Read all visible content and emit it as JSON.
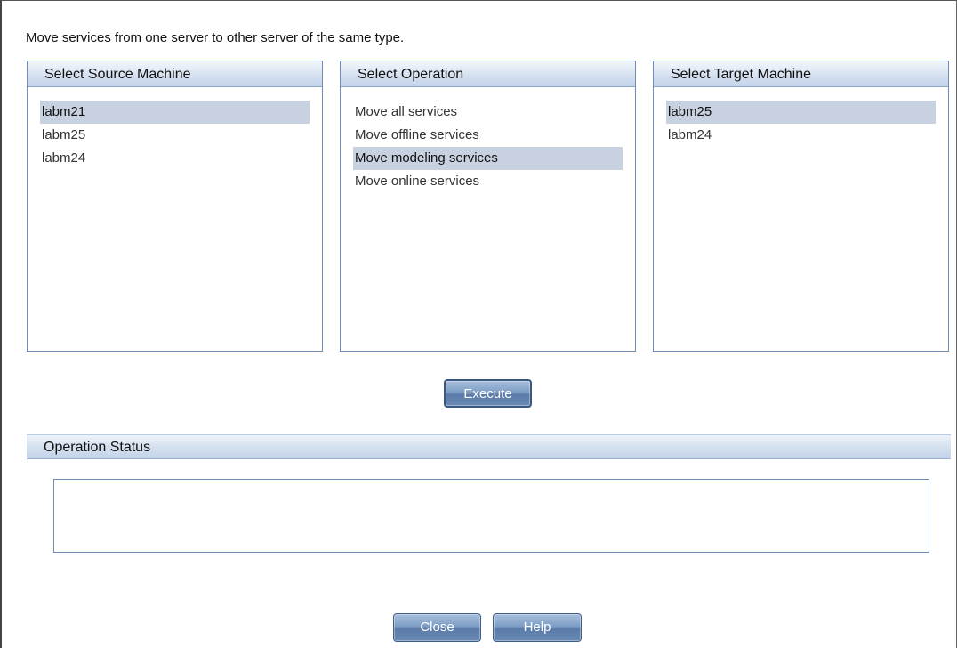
{
  "description": "Move services from one server to other server of the same type.",
  "source_panel": {
    "title": "Select Source Machine",
    "items": [
      "labm21",
      "labm25",
      "labm24"
    ],
    "selected": "labm21"
  },
  "operation_panel": {
    "title": "Select Operation",
    "items": [
      "Move all services",
      "Move offline services",
      "Move modeling services",
      "Move online services"
    ],
    "selected": "Move modeling services"
  },
  "target_panel": {
    "title": "Select Target Machine",
    "items": [
      "labm25",
      "labm24"
    ],
    "selected": "labm25"
  },
  "buttons": {
    "execute": "Execute",
    "close": "Close",
    "help": "Help"
  },
  "status": {
    "title": "Operation Status",
    "text": ""
  },
  "colors": {
    "selection": "#c8d1df",
    "header": "#d6e1f0",
    "button": "#6a8ab5"
  }
}
